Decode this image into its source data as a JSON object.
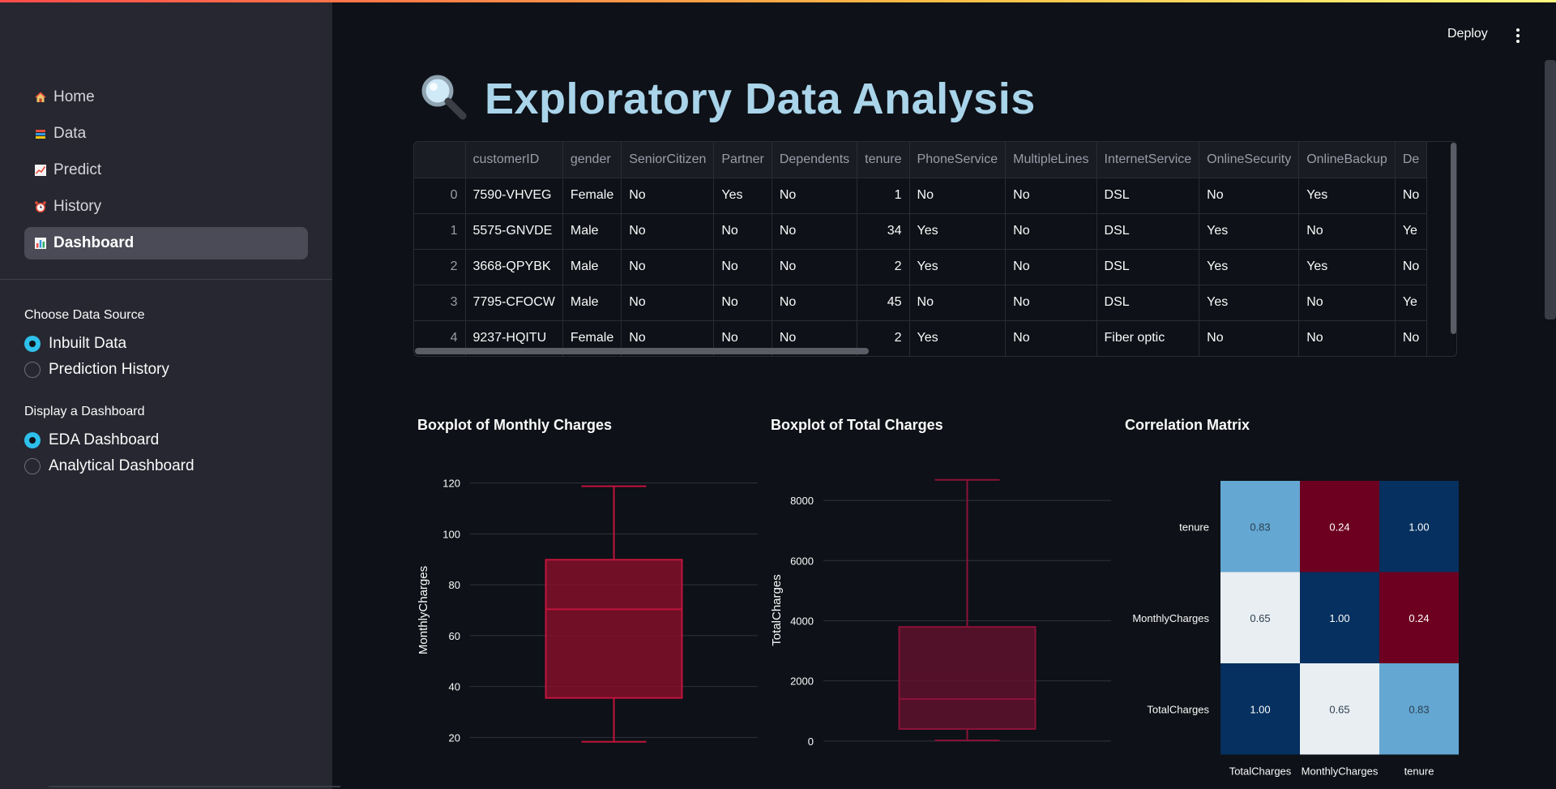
{
  "header": {
    "deploy_label": "Deploy"
  },
  "sidebar": {
    "nav": [
      {
        "label": "Home",
        "icon": "house-icon",
        "active": false
      },
      {
        "label": "Data",
        "icon": "books-icon",
        "active": false
      },
      {
        "label": "Predict",
        "icon": "chart-increasing-icon",
        "active": false
      },
      {
        "label": "History",
        "icon": "alarm-clock-icon",
        "active": false
      },
      {
        "label": "Dashboard",
        "icon": "bar-chart-icon",
        "active": true
      }
    ],
    "data_source": {
      "label": "Choose Data Source",
      "options": [
        "Inbuilt Data",
        "Prediction History"
      ],
      "selected": "Inbuilt Data"
    },
    "dashboard": {
      "label": "Display a Dashboard",
      "options": [
        "EDA Dashboard",
        "Analytical Dashboard"
      ],
      "selected": "EDA Dashboard"
    }
  },
  "main": {
    "title": "Exploratory Data Analysis",
    "title_icon": "magnifying-glass-icon",
    "table": {
      "columns": [
        "",
        "customerID",
        "gender",
        "SeniorCitizen",
        "Partner",
        "Dependents",
        "tenure",
        "PhoneService",
        "MultipleLines",
        "InternetService",
        "OnlineSecurity",
        "OnlineBackup",
        "De"
      ],
      "rows": [
        [
          "0",
          "7590-VHVEG",
          "Female",
          "No",
          "Yes",
          "No",
          "1",
          "No",
          "No",
          "DSL",
          "No",
          "Yes",
          "No"
        ],
        [
          "1",
          "5575-GNVDE",
          "Male",
          "No",
          "No",
          "No",
          "34",
          "Yes",
          "No",
          "DSL",
          "Yes",
          "No",
          "Ye"
        ],
        [
          "2",
          "3668-QPYBK",
          "Male",
          "No",
          "No",
          "No",
          "2",
          "Yes",
          "No",
          "DSL",
          "Yes",
          "Yes",
          "No"
        ],
        [
          "3",
          "7795-CFOCW",
          "Male",
          "No",
          "No",
          "No",
          "45",
          "No",
          "No",
          "DSL",
          "Yes",
          "No",
          "Ye"
        ],
        [
          "4",
          "9237-HQITU",
          "Female",
          "No",
          "No",
          "No",
          "2",
          "Yes",
          "No",
          "Fiber optic",
          "No",
          "No",
          "No"
        ]
      ]
    },
    "charts": {
      "monthly_title": "Boxplot of Monthly Charges",
      "total_title": "Boxplot of Total Charges",
      "corr_title": "Correlation Matrix",
      "monthly_ylabel": "MonthlyCharges",
      "total_ylabel": "TotalCharges"
    }
  },
  "chart_data": [
    {
      "type": "box",
      "title": "Boxplot of Monthly Charges",
      "ylabel": "MonthlyCharges",
      "ylim": [
        15,
        125
      ],
      "yticks": [
        20,
        40,
        60,
        80,
        100,
        120
      ],
      "min": 18.25,
      "q1": 35.5,
      "median": 70.35,
      "q3": 89.85,
      "max": 118.75,
      "color": "#c0143c"
    },
    {
      "type": "box",
      "title": "Boxplot of Total Charges",
      "ylabel": "TotalCharges",
      "ylim": [
        -300,
        9000
      ],
      "yticks": [
        0,
        2000,
        4000,
        6000,
        8000
      ],
      "min": 18.8,
      "q1": 401.45,
      "median": 1397.5,
      "q3": 3794.7,
      "max": 8684.8,
      "color": "#8a1238"
    },
    {
      "type": "heatmap",
      "title": "Correlation Matrix",
      "rows": [
        "tenure",
        "MonthlyCharges",
        "TotalCharges"
      ],
      "cols": [
        "TotalCharges",
        "MonthlyCharges",
        "tenure"
      ],
      "values": [
        [
          0.83,
          0.24,
          1.0
        ],
        [
          0.65,
          1.0,
          0.24
        ],
        [
          1.0,
          0.65,
          0.83
        ]
      ]
    }
  ]
}
